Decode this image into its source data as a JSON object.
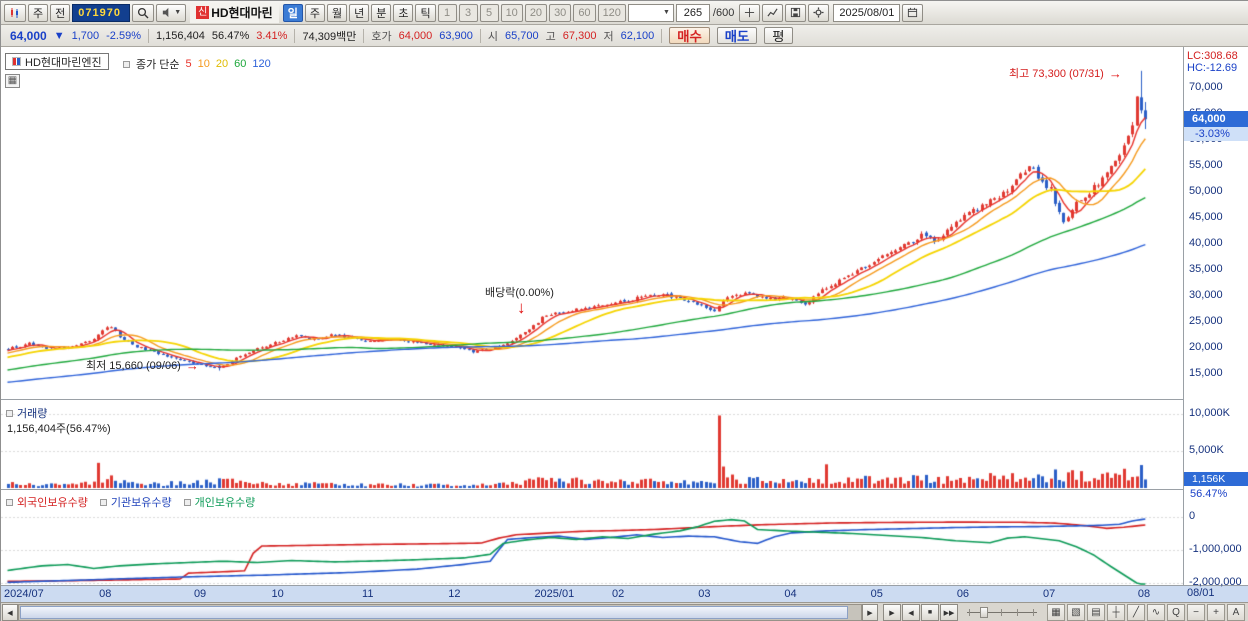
{
  "colors": {
    "up": "#e03a32",
    "down": "#2b5fc7",
    "ma5": "#e8332b",
    "ma10": "#f59a1e",
    "ma20": "#f5d400",
    "ma60": "#1ea83c",
    "ma120": "#2e62d9",
    "foreign": "#d42222",
    "inst": "#2255cc",
    "indiv": "#0c9a57",
    "accent_blue": "#2e6bd6"
  },
  "icons": {
    "dropdown": "▼",
    "arrow_right": "→",
    "arrow_down": "↓",
    "scroll_left": "◀",
    "scroll_right": "▶",
    "play": "▶",
    "rewind": "◀",
    "stop": "■",
    "fast_forward": "▶▶",
    "grid": "▦"
  },
  "toolbar": {
    "week_btn": "주",
    "prev_btn": "전",
    "code": "071970",
    "stock_badge": "신",
    "stock_name": "HD현대마린",
    "periods": [
      "일",
      "주",
      "월",
      "년"
    ],
    "sub_periods": [
      "분",
      "초",
      "틱"
    ],
    "intervals": [
      "1",
      "3",
      "5",
      "10",
      "20",
      "30",
      "60",
      "120"
    ],
    "bar_count": "265",
    "bar_total": "/600",
    "date": "2025/08/01"
  },
  "quote": {
    "price": "64,000",
    "arrow": "▼",
    "change": "1,700",
    "change_pct": "-2.59%",
    "volume": "1,156,404",
    "volume_ratio": "56.47%",
    "turnover": "3.41%",
    "amount": "74,309백만",
    "hoga_label": "호가",
    "ask": "64,000",
    "bid": "63,900",
    "open_label": "시",
    "open": "65,700",
    "high_label": "고",
    "high": "67,300",
    "low_label": "저",
    "low": "62,100",
    "buy": "매수",
    "sell": "매도",
    "avg": "평"
  },
  "price_panel": {
    "stock_label": "HD현대마린엔진",
    "legend_prefix": "종가 단순",
    "legend_periods": [
      "5",
      "10",
      "20",
      "60",
      "120"
    ],
    "lc": "LC:308.68",
    "hc": "HC:-12.69",
    "high_annotation": "최고 73,300 (07/31)",
    "div_annotation": "배당락(0.00%)",
    "low_annotation": "최저 15,660 (09/06)",
    "price_badge": "64,000",
    "pct_badge": "-3.03%",
    "axis": [
      "70,000",
      "65,000",
      "60,000",
      "55,000",
      "50,000",
      "45,000",
      "40,000",
      "35,000",
      "30,000",
      "25,000",
      "20,000",
      "15,000"
    ]
  },
  "volume_panel": {
    "label": "거래량",
    "value": "1,156,404주(56.47%)",
    "axis": [
      "10,000K",
      "5,000K"
    ],
    "badge": "1,156K",
    "badge_pct": "56.47%"
  },
  "holdings_panel": {
    "labels": [
      "외국인보유수량",
      "기관보유수량",
      "개인보유수량"
    ],
    "axis": [
      "0",
      "-1,000,000",
      "-2,000,000"
    ]
  },
  "xaxis": {
    "labels": [
      "2024/07",
      "08",
      "09",
      "10",
      "11",
      "12",
      "2025/01",
      "02",
      "03",
      "04",
      "05",
      "06",
      "07",
      "08"
    ],
    "right_label": "08/01"
  },
  "bottombar": {
    "tool_icons": [
      "▦",
      "▧",
      "▤",
      "┼",
      "╱",
      "∿",
      "Q",
      "−",
      "+",
      "A"
    ]
  },
  "chart_data": {
    "type": "candlestick",
    "days": 265,
    "prehistory_days": 120,
    "price_axis_values": [
      70000,
      65000,
      60000,
      55000,
      50000,
      45000,
      40000,
      35000,
      30000,
      25000,
      20000,
      15000
    ],
    "volume_axis_k": [
      10000,
      5000
    ],
    "holdings_axis": [
      0,
      -1000000,
      -2000000
    ],
    "month_starts": [
      0,
      23,
      45,
      63,
      84,
      104,
      124,
      142,
      162,
      182,
      202,
      222,
      242,
      264
    ],
    "prehistory_anchors": [
      [
        -120,
        9500
      ],
      [
        -60,
        12500
      ],
      [
        -30,
        15500
      ],
      [
        -10,
        18000
      ]
    ],
    "price_anchors": [
      [
        0,
        19800
      ],
      [
        5,
        20800
      ],
      [
        10,
        19600
      ],
      [
        15,
        20300
      ],
      [
        20,
        21600
      ],
      [
        22,
        23300
      ],
      [
        24,
        24200
      ],
      [
        26,
        22200
      ],
      [
        29,
        20600
      ],
      [
        33,
        19500
      ],
      [
        38,
        18300
      ],
      [
        42,
        17200
      ],
      [
        45,
        16800
      ],
      [
        48,
        16300
      ],
      [
        49,
        16200
      ],
      [
        53,
        18000
      ],
      [
        58,
        19800
      ],
      [
        63,
        21200
      ],
      [
        67,
        22400
      ],
      [
        71,
        21600
      ],
      [
        76,
        22600
      ],
      [
        80,
        21900
      ],
      [
        84,
        21400
      ],
      [
        89,
        21800
      ],
      [
        94,
        21100
      ],
      [
        99,
        20700
      ],
      [
        104,
        20200
      ],
      [
        108,
        19300
      ],
      [
        112,
        19900
      ],
      [
        117,
        21200
      ],
      [
        121,
        23500
      ],
      [
        124,
        25800
      ],
      [
        128,
        26800
      ],
      [
        134,
        27600
      ],
      [
        138,
        28200
      ],
      [
        142,
        28800
      ],
      [
        147,
        29800
      ],
      [
        152,
        30400
      ],
      [
        157,
        29200
      ],
      [
        162,
        28000
      ],
      [
        164,
        27200
      ],
      [
        167,
        29600
      ],
      [
        172,
        30600
      ],
      [
        176,
        29400
      ],
      [
        182,
        29800
      ],
      [
        185,
        28400
      ],
      [
        189,
        31000
      ],
      [
        194,
        33500
      ],
      [
        199,
        35800
      ],
      [
        202,
        37200
      ],
      [
        207,
        39300
      ],
      [
        212,
        41600
      ],
      [
        215,
        40600
      ],
      [
        219,
        43200
      ],
      [
        222,
        45200
      ],
      [
        227,
        47800
      ],
      [
        232,
        50300
      ],
      [
        237,
        55000
      ],
      [
        240,
        52200
      ],
      [
        242,
        50400
      ],
      [
        245,
        43800
      ],
      [
        248,
        47600
      ],
      [
        252,
        50800
      ],
      [
        255,
        53400
      ],
      [
        258,
        57500
      ],
      [
        259,
        59000
      ],
      [
        260,
        60500
      ],
      [
        261,
        63000
      ],
      [
        262,
        68500
      ],
      [
        263,
        65700
      ],
      [
        264,
        64000
      ]
    ],
    "special": {
      "low_day": 49,
      "low_price": 15660,
      "low_day_ohlc": [
        16600,
        16750,
        15660,
        16150
      ],
      "high_day": 263,
      "high_price": 73300,
      "prev_day_ohlc": [
        68200,
        73300,
        65100,
        65700
      ],
      "last_day_ohlc": [
        65700,
        67300,
        62100,
        64000
      ]
    },
    "ma_periods": [
      5,
      10,
      20,
      60,
      120
    ],
    "volume_anchors_k": [
      [
        0,
        550
      ],
      [
        10,
        420
      ],
      [
        20,
        650
      ],
      [
        26,
        900
      ],
      [
        33,
        500
      ],
      [
        45,
        750
      ],
      [
        49,
        1100
      ],
      [
        60,
        480
      ],
      [
        75,
        520
      ],
      [
        90,
        420
      ],
      [
        104,
        380
      ],
      [
        115,
        520
      ],
      [
        121,
        950
      ],
      [
        128,
        1100
      ],
      [
        135,
        780
      ],
      [
        145,
        850
      ],
      [
        155,
        780
      ],
      [
        163,
        950
      ],
      [
        168,
        1300
      ],
      [
        175,
        950
      ],
      [
        183,
        1100
      ],
      [
        192,
        1200
      ],
      [
        202,
        1050
      ],
      [
        212,
        1150
      ],
      [
        222,
        1250
      ],
      [
        232,
        1350
      ],
      [
        240,
        1300
      ],
      [
        245,
        1900
      ],
      [
        252,
        1300
      ],
      [
        258,
        1700
      ],
      [
        262,
        2300
      ],
      [
        264,
        1200
      ]
    ],
    "volume_spikes_k": {
      "21": 3400,
      "24": 1700,
      "165": 9800,
      "166": 2900,
      "190": 3200,
      "247": 2400,
      "259": 2600,
      "263": 3100,
      "264": 1156
    },
    "holdings": {
      "foreign_anchors": [
        [
          0,
          -1950000
        ],
        [
          15,
          -1930000
        ],
        [
          30,
          -1900000
        ],
        [
          40,
          -1880000
        ],
        [
          42,
          -1700000
        ],
        [
          50,
          -1660000
        ],
        [
          55,
          -1630000
        ],
        [
          57,
          -1100000
        ],
        [
          59,
          -880000
        ],
        [
          70,
          -860000
        ],
        [
          85,
          -830000
        ],
        [
          100,
          -810000
        ],
        [
          110,
          -790000
        ],
        [
          114,
          -640000
        ],
        [
          118,
          -540000
        ],
        [
          126,
          -480000
        ],
        [
          134,
          -430000
        ],
        [
          142,
          -410000
        ],
        [
          150,
          -380000
        ],
        [
          158,
          -330000
        ],
        [
          166,
          -280000
        ],
        [
          174,
          -240000
        ],
        [
          182,
          -210000
        ],
        [
          192,
          -180000
        ],
        [
          205,
          -165000
        ],
        [
          220,
          -155000
        ],
        [
          235,
          -160000
        ],
        [
          243,
          -185000
        ],
        [
          250,
          -260000
        ],
        [
          255,
          -345000
        ],
        [
          259,
          -310000
        ],
        [
          262,
          -270000
        ],
        [
          264,
          -240000
        ]
      ],
      "institution_anchors": [
        [
          0,
          -1980000
        ],
        [
          20,
          -1900000
        ],
        [
          40,
          -1820000
        ],
        [
          60,
          -1760000
        ],
        [
          80,
          -1680000
        ],
        [
          95,
          -1580000
        ],
        [
          105,
          -1450000
        ],
        [
          112,
          -1340000
        ],
        [
          114,
          -1000000
        ],
        [
          116,
          -680000
        ],
        [
          122,
          -620000
        ],
        [
          128,
          -580000
        ],
        [
          134,
          -680000
        ],
        [
          140,
          -620000
        ],
        [
          146,
          -540000
        ],
        [
          152,
          -620000
        ],
        [
          158,
          -580000
        ],
        [
          164,
          -600000
        ],
        [
          170,
          -750000
        ],
        [
          174,
          -800000
        ],
        [
          178,
          -600000
        ],
        [
          182,
          -480000
        ],
        [
          190,
          -420000
        ],
        [
          200,
          -380000
        ],
        [
          210,
          -350000
        ],
        [
          220,
          -320000
        ],
        [
          230,
          -300000
        ],
        [
          240,
          -290000
        ],
        [
          248,
          -270000
        ],
        [
          254,
          -250000
        ],
        [
          258,
          -220000
        ],
        [
          261,
          -120000
        ],
        [
          264,
          -60000
        ]
      ],
      "individual_anchors": [
        [
          0,
          -1620000
        ],
        [
          8,
          -1480000
        ],
        [
          14,
          -1440000
        ],
        [
          20,
          -1560000
        ],
        [
          26,
          -1480000
        ],
        [
          34,
          -1420000
        ],
        [
          42,
          -1380000
        ],
        [
          50,
          -1340000
        ],
        [
          58,
          -1380000
        ],
        [
          66,
          -1320000
        ],
        [
          76,
          -1360000
        ],
        [
          86,
          -1330000
        ],
        [
          96,
          -1290000
        ],
        [
          106,
          -1240000
        ],
        [
          112,
          -1130000
        ],
        [
          115,
          -800000
        ],
        [
          120,
          -700000
        ],
        [
          126,
          -620000
        ],
        [
          132,
          -680000
        ],
        [
          138,
          -600000
        ],
        [
          144,
          -650000
        ],
        [
          150,
          -520000
        ],
        [
          156,
          -420000
        ],
        [
          160,
          -300000
        ],
        [
          164,
          -130000
        ],
        [
          168,
          -80000
        ],
        [
          171,
          -120000
        ],
        [
          174,
          -380000
        ],
        [
          180,
          -420000
        ],
        [
          188,
          -460000
        ],
        [
          196,
          -500000
        ],
        [
          204,
          -560000
        ],
        [
          212,
          -620000
        ],
        [
          220,
          -720000
        ],
        [
          228,
          -780000
        ],
        [
          232,
          -640000
        ],
        [
          236,
          -600000
        ],
        [
          240,
          -660000
        ],
        [
          244,
          -720000
        ],
        [
          248,
          -900000
        ],
        [
          252,
          -1150000
        ],
        [
          256,
          -1500000
        ],
        [
          259,
          -1750000
        ],
        [
          262,
          -2000000
        ],
        [
          264,
          -2120000
        ]
      ]
    }
  }
}
